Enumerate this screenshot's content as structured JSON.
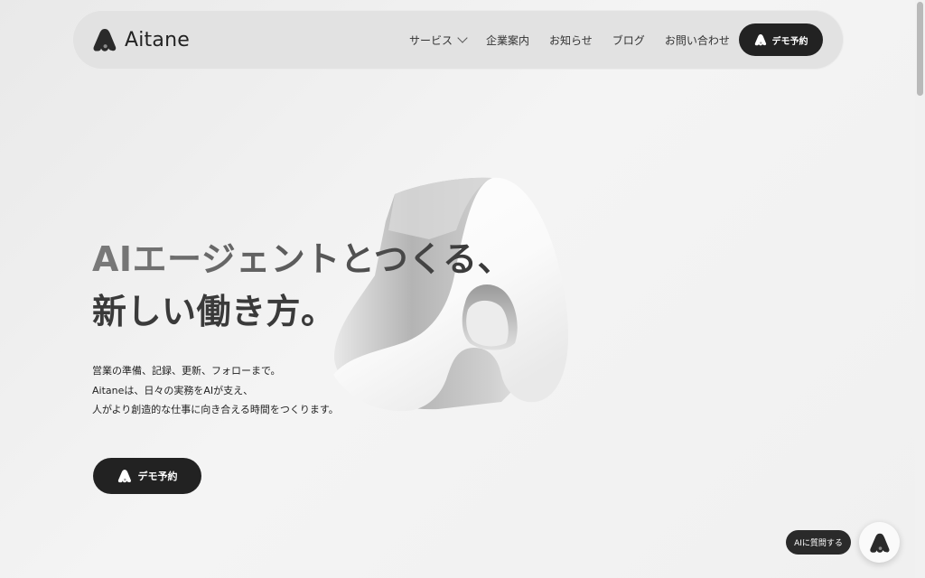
{
  "header": {
    "brand_name": "Aitane",
    "nav": [
      {
        "label": "サービス",
        "has_dropdown": true
      },
      {
        "label": "企業案内"
      },
      {
        "label": "お知らせ"
      },
      {
        "label": "ブログ"
      },
      {
        "label": "お問い合わせ"
      }
    ],
    "demo_label": "デモ予約"
  },
  "hero": {
    "title_line1": "AIエージェントとつくる、",
    "title_line2": "新しい働き方。",
    "description": [
      "営業の準備、記録、更新、フォローまで。",
      "Aitaneは、日々の実務をAIが支え、",
      "人がより創造的な仕事に向き合える時間をつくります。"
    ],
    "cta_label": "デモ予約"
  },
  "chat": {
    "label": "AIに質問する"
  },
  "colors": {
    "dark": "#222222",
    "header_bg": "#e2e2e2",
    "page_bg": "#efefef"
  },
  "icons": {
    "logo": "aitane-logo-icon",
    "dropdown": "chevron-down-icon"
  }
}
